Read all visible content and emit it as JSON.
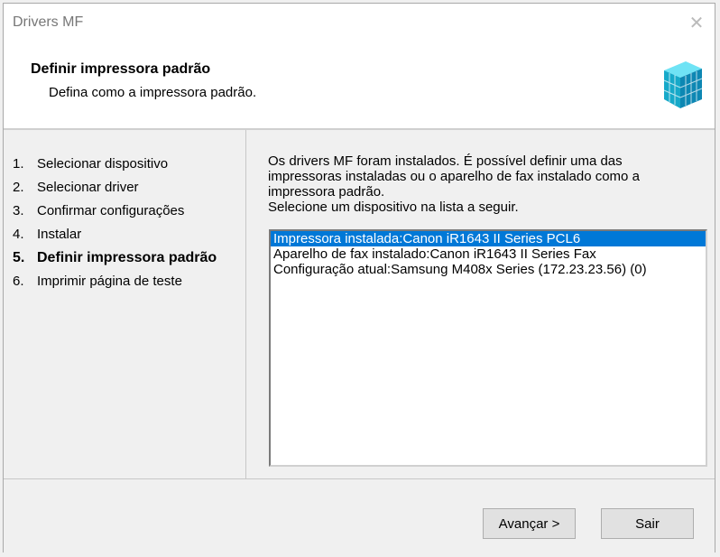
{
  "window": {
    "title": "Drivers MF"
  },
  "header": {
    "title": "Definir impressora padrão",
    "subtitle": "Defina como a impressora padrão."
  },
  "steps": [
    {
      "num": "1.",
      "label": "Selecionar dispositivo"
    },
    {
      "num": "2.",
      "label": "Selecionar driver"
    },
    {
      "num": "3.",
      "label": "Confirmar configurações"
    },
    {
      "num": "4.",
      "label": "Instalar"
    },
    {
      "num": "5.",
      "label": "Definir impressora padrão"
    },
    {
      "num": "6.",
      "label": "Imprimir página de teste"
    }
  ],
  "content": {
    "description_1": "Os drivers MF foram instalados. É possível definir uma das impressoras instaladas ou o aparelho de fax instalado como a impressora padrão.",
    "description_2": "Selecione um dispositivo na lista a seguir.",
    "devices": [
      "Impressora instalada:Canon iR1643 II Series PCL6",
      "Aparelho de fax instalado:Canon iR1643 II Series Fax",
      "Configuração atual:Samsung M408x Series (172.23.23.56) (0)"
    ]
  },
  "buttons": {
    "next": "Avançar >",
    "exit": "Sair"
  },
  "colors": {
    "selection": "#0078d7"
  }
}
